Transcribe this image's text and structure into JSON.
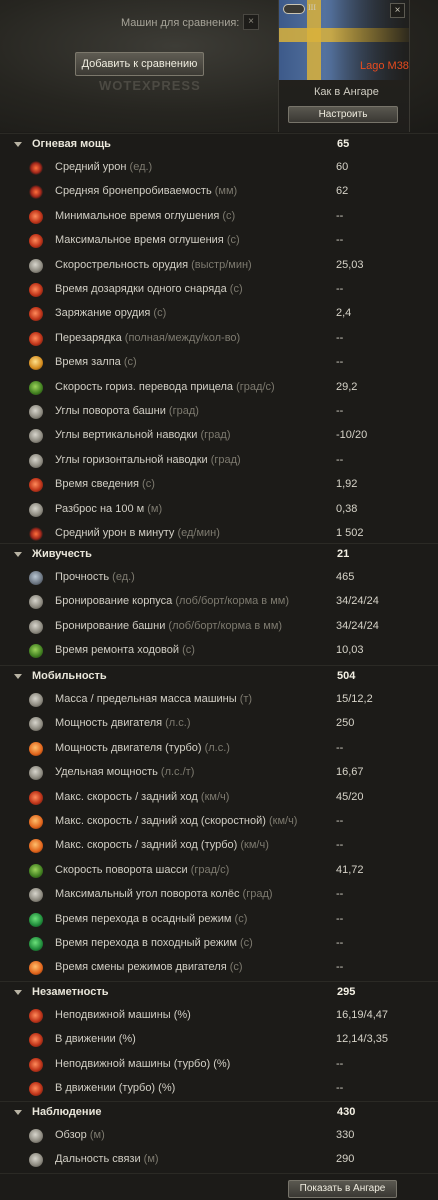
{
  "header": {
    "compare_label": "Машин для сравнения: 1",
    "compare_close": "×",
    "add_button": "Добавить к сравнению",
    "watermark": "WOTEXPRESS"
  },
  "tank": {
    "tier": "III",
    "name": "Lago M38",
    "close": "×",
    "hangar_label": "Как в Ангаре",
    "configure_button": "Настроить"
  },
  "colors": {
    "tank_name": "#e74b1f",
    "accent": "#f3f0e4",
    "background": "#1c1b18"
  },
  "sections": [
    {
      "title": "Огневая мощь",
      "value": "65",
      "rows": [
        {
          "icon": "shell-damage-icon",
          "label": "Средний урон",
          "unit": "(ед.)",
          "value": "60"
        },
        {
          "icon": "shell-penetration-icon",
          "label": "Средняя бронепробиваемость",
          "unit": "(мм)",
          "value": "62"
        },
        {
          "icon": "stun-min-icon",
          "label": "Минимальное время оглушения",
          "unit": "(с)",
          "value": "--"
        },
        {
          "icon": "stun-max-icon",
          "label": "Максимальное время оглушения",
          "unit": "(с)",
          "value": "--"
        },
        {
          "icon": "rate-of-fire-icon",
          "label": "Скорострельность орудия",
          "unit": "(выстр/мин)",
          "value": "25,03"
        },
        {
          "icon": "shell-reload-icon",
          "label": "Время дозарядки одного снаряда",
          "unit": "(с)",
          "value": "--"
        },
        {
          "icon": "reload-icon",
          "label": "Заряжание орудия",
          "unit": "(с)",
          "value": "2,4"
        },
        {
          "icon": "autoreload-icon",
          "label": "Перезарядка",
          "unit": "(полная/между/кол-во)",
          "value": "--"
        },
        {
          "icon": "volley-icon",
          "label": "Время залпа",
          "unit": "(с)",
          "value": "--"
        },
        {
          "icon": "traverse-aim-icon",
          "label": "Скорость гориз. перевода прицела",
          "unit": "(град/с)",
          "value": "29,2"
        },
        {
          "icon": "turret-rotation-icon",
          "label": "Углы поворота башни",
          "unit": "(град)",
          "value": "--"
        },
        {
          "icon": "vertical-aim-icon",
          "label": "Углы вертикальной наводки",
          "unit": "(град)",
          "value": "-10/20"
        },
        {
          "icon": "horizontal-aim-icon",
          "label": "Углы горизонтальной наводки",
          "unit": "(град)",
          "value": "--"
        },
        {
          "icon": "aim-time-icon",
          "label": "Время сведения",
          "unit": "(с)",
          "value": "1,92"
        },
        {
          "icon": "dispersion-icon",
          "label": "Разброс на 100 м",
          "unit": "(м)",
          "value": "0,38"
        },
        {
          "icon": "dpm-icon",
          "label": "Средний урон в минуту",
          "unit": "(ед/мин)",
          "value": "1 502"
        }
      ]
    },
    {
      "title": "Живучесть",
      "value": "21",
      "rows": [
        {
          "icon": "hitpoints-icon",
          "label": "Прочность",
          "unit": "(ед.)",
          "value": "465"
        },
        {
          "icon": "hull-armor-icon",
          "label": "Бронирование корпуса",
          "unit": "(лоб/борт/корма в мм)",
          "value": "34/24/24"
        },
        {
          "icon": "turret-armor-icon",
          "label": "Бронирование башни",
          "unit": "(лоб/борт/корма в мм)",
          "value": "34/24/24"
        },
        {
          "icon": "track-repair-icon",
          "label": "Время ремонта ходовой",
          "unit": "(с)",
          "value": "10,03"
        }
      ]
    },
    {
      "title": "Мобильность",
      "value": "504",
      "rows": [
        {
          "icon": "weight-icon",
          "label": "Масса / предельная масса машины",
          "unit": "(т)",
          "value": "15/12,2"
        },
        {
          "icon": "engine-power-icon",
          "label": "Мощность двигателя",
          "unit": "(л.с.)",
          "value": "250"
        },
        {
          "icon": "engine-turbo-icon",
          "label": "Мощность двигателя (турбо)",
          "unit": "(л.с.)",
          "value": "--"
        },
        {
          "icon": "specific-power-icon",
          "label": "Удельная мощность",
          "unit": "(л.с./т)",
          "value": "16,67"
        },
        {
          "icon": "speed-limits-icon",
          "label": "Макс. скорость / задний ход",
          "unit": "(км/ч)",
          "value": "45/20"
        },
        {
          "icon": "speed-fast-icon",
          "label": "Макс. скорость / задний ход (скоростной)",
          "unit": "(км/ч)",
          "value": "--"
        },
        {
          "icon": "speed-turbo-icon",
          "label": "Макс. скорость / задний ход (турбо)",
          "unit": "(км/ч)",
          "value": "--"
        },
        {
          "icon": "chassis-rotation-icon",
          "label": "Скорость поворота шасси",
          "unit": "(град/с)",
          "value": "41,72"
        },
        {
          "icon": "wheel-angle-icon",
          "label": "Максимальный угол поворота колёс",
          "unit": "(град)",
          "value": "--"
        },
        {
          "icon": "siege-mode-icon",
          "label": "Время перехода в осадный режим",
          "unit": " (с)",
          "value": "--"
        },
        {
          "icon": "travel-mode-icon",
          "label": "Время перехода в походный режим",
          "unit": " (с)",
          "value": "--"
        },
        {
          "icon": "engine-mode-icon",
          "label": "Время смены режимов двигателя",
          "unit": "(с)",
          "value": "--"
        }
      ]
    },
    {
      "title": "Незаметность",
      "value": "295",
      "rows": [
        {
          "icon": "camo-still-icon",
          "label": "Неподвижной машины (%)",
          "unit": "",
          "value": "16,19/4,47"
        },
        {
          "icon": "camo-moving-icon",
          "label": "В движении (%)",
          "unit": "",
          "value": "12,14/3,35"
        },
        {
          "icon": "camo-still-turbo-icon",
          "label": "Неподвижной машины (турбо) (%)",
          "unit": "",
          "value": "--"
        },
        {
          "icon": "camo-moving-turbo-icon",
          "label": "В движении (турбо) (%)",
          "unit": "",
          "value": "--"
        }
      ]
    },
    {
      "title": "Наблюдение",
      "value": "430",
      "rows": [
        {
          "icon": "view-range-icon",
          "label": "Обзор",
          "unit": "(м)",
          "value": "330"
        },
        {
          "icon": "radio-range-icon",
          "label": "Дальность связи",
          "unit": "(м)",
          "value": "290"
        }
      ]
    }
  ],
  "footer": {
    "show_in_hangar": "Показать в Ангаре"
  }
}
